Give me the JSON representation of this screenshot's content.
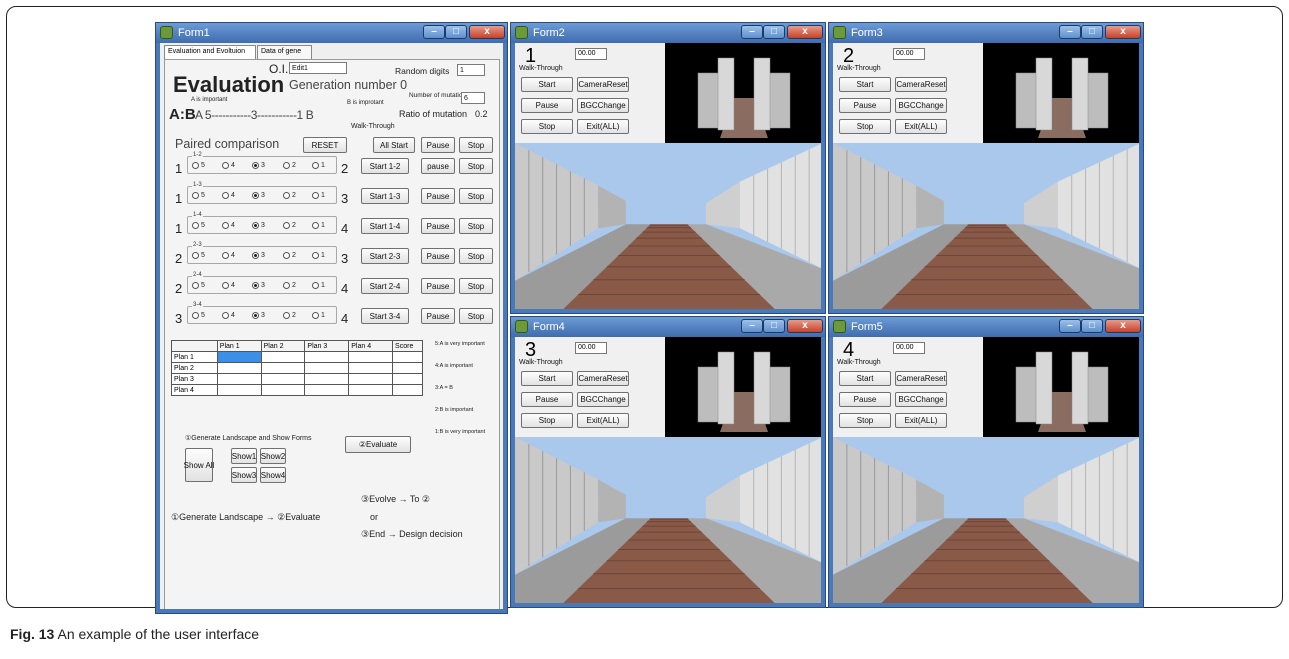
{
  "figure": {
    "label": "Fig. 13",
    "text": "An example of the user interface"
  },
  "colors": {
    "window_frame": "#4a79b8",
    "client_bg": "#efefef",
    "sky": "#a9c8ec",
    "brick": "#8a5a48",
    "selected_cell": "#3b8fe6"
  },
  "form1": {
    "title": "Form1",
    "tabs": [
      "Evaluation and Evoltuion",
      "Data of gene"
    ],
    "oi_label": "O.I.",
    "oi_value": "Edit1",
    "evaluation_title": "Evaluation",
    "generation_text": "Generation number 0",
    "random_digits_label": "Random digits",
    "random_digits_value": "1",
    "a_important": "A is important",
    "b_important": "B is improtant",
    "mutation_number_label": "Number of mutation",
    "mutation_number_value": "6",
    "ab_label": "A:B",
    "scale_text": "A 5-----------3-----------1 B",
    "ratio_mutation_label": "Ratio of mutation",
    "ratio_mutation_value": "0.2",
    "walk_through_label": "Walk-Through",
    "paired_label": "Paired comparison",
    "reset_label": "RESET",
    "all_start_label": "All Start",
    "pause_label": "Pause",
    "stop_label": "Stop",
    "radio_labels": [
      "5",
      "4",
      "3",
      "2",
      "1"
    ],
    "pairs": [
      {
        "group": "1-2",
        "left": "1",
        "right": "2",
        "start": "Start 1-2",
        "pause": "pause",
        "stop": "Stop"
      },
      {
        "group": "1-3",
        "left": "1",
        "right": "3",
        "start": "Start 1-3",
        "pause": "Pause",
        "stop": "Stop"
      },
      {
        "group": "1-4",
        "left": "1",
        "right": "4",
        "start": "Start 1-4",
        "pause": "Pause",
        "stop": "Stop"
      },
      {
        "group": "2-3",
        "left": "2",
        "right": "3",
        "start": "Start 2-3",
        "pause": "Pause",
        "stop": "Stop"
      },
      {
        "group": "2-4",
        "left": "2",
        "right": "4",
        "start": "Start 2-4",
        "pause": "Pause",
        "stop": "Stop"
      },
      {
        "group": "3-4",
        "left": "3",
        "right": "4",
        "start": "Start 3-4",
        "pause": "Pause",
        "stop": "Stop"
      }
    ],
    "table": {
      "headers": [
        "",
        "Plan 1",
        "Plan 2",
        "Plan 3",
        "Plan 4",
        "Score"
      ],
      "rows": [
        "Plan 1",
        "Plan 2",
        "Plan 3",
        "Plan 4"
      ]
    },
    "legend": [
      "5:A is very important",
      "4:A is important",
      "3:A = B",
      "2:B is important",
      "1:B is very important"
    ],
    "generate_label": "①Generate Landscape and Show Forms",
    "evaluate_label": "②Evaluate",
    "show_all": "Show All",
    "show_buttons": [
      "Show1",
      "Show2",
      "Show3",
      "Show4"
    ],
    "flow_evolve": "③Evolve →   To ②",
    "flow_main": "①Generate Landscape  →  ②Evaluate",
    "flow_or": "or",
    "flow_end": "③End    →   Design decision"
  },
  "walk_forms": [
    {
      "title": "Form2",
      "number": "1",
      "walk": "Walk-Through",
      "time": "00.00",
      "start": "Start",
      "camera": "CameraReset",
      "pause": "Pause",
      "bgc": "BGCChange",
      "stop": "Stop",
      "exit": "Exit(ALL)"
    },
    {
      "title": "Form3",
      "number": "2",
      "walk": "Walk-Through",
      "time": "00.00",
      "start": "Start",
      "camera": "CameraReset",
      "pause": "Pause",
      "bgc": "BGCChange",
      "stop": "Stop",
      "exit": "Exit(ALL)"
    },
    {
      "title": "Form4",
      "number": "3",
      "walk": "Walk-Through",
      "time": "00.00",
      "start": "Start",
      "camera": "CameraReset",
      "pause": "Pause",
      "bgc": "BGCChange",
      "stop": "Stop",
      "exit": "Exit(ALL)"
    },
    {
      "title": "Form5",
      "number": "4",
      "walk": "Walk-Through",
      "time": "00.00",
      "start": "Start",
      "camera": "CameraReset",
      "pause": "Pause",
      "bgc": "BGCChange",
      "stop": "Stop",
      "exit": "Exit(ALL)"
    }
  ],
  "window_buttons": {
    "min": "–",
    "max": "□",
    "close": "x"
  }
}
